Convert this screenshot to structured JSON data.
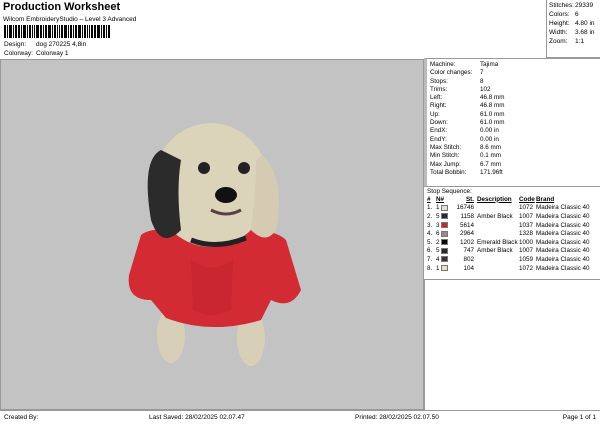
{
  "header": {
    "title": "Production Worksheet",
    "subtitle": "Wilcom EmbroideryStudio – Level 3 Advanced",
    "design_label": "Design:",
    "design_value": "dog 270225 4,8in",
    "colorway_label": "Colorway:",
    "colorway_value": "Colorway 1"
  },
  "stats": [
    {
      "k": "Stitches:",
      "v": "29339"
    },
    {
      "k": "Colors:",
      "v": "6"
    },
    {
      "k": "Height:",
      "v": "4.80 in"
    },
    {
      "k": "Width:",
      "v": "3.68 in"
    },
    {
      "k": "Zoom:",
      "v": "1:1"
    }
  ],
  "info": [
    {
      "k": "Machine:",
      "v": "Tajima"
    },
    {
      "k": "Color changes:",
      "v": "7"
    },
    {
      "k": "Stops:",
      "v": "8"
    },
    {
      "k": "Trims:",
      "v": "102"
    },
    {
      "k": "Left:",
      "v": "46.8 mm"
    },
    {
      "k": "Right:",
      "v": "46.8 mm"
    },
    {
      "k": "Up:",
      "v": "61.0 mm"
    },
    {
      "k": "Down:",
      "v": "61.0 mm"
    },
    {
      "k": "EndX:",
      "v": "0.00 in"
    },
    {
      "k": "EndY:",
      "v": "0.00 in"
    },
    {
      "k": "Max Stitch:",
      "v": "8.6 mm"
    },
    {
      "k": "Min Stitch:",
      "v": "0.1 mm"
    },
    {
      "k": "Max Jump:",
      "v": "6.7 mm"
    },
    {
      "k": "Total Bobbin:",
      "v": "171.96ft"
    }
  ],
  "sequence": {
    "title": "Stop Sequence:",
    "headers": [
      "#",
      "N#",
      "St.",
      "Description",
      "Code",
      "Brand"
    ],
    "rows": [
      {
        "n": "1.",
        "c": "1",
        "color": "#e6dfcf",
        "st": "16746",
        "desc": "",
        "code": "1072",
        "brand": "Madeira Classic 40"
      },
      {
        "n": "2.",
        "c": "5",
        "color": "#2a2a2a",
        "st": "1158",
        "desc": "Amber Black",
        "code": "1007",
        "brand": "Madeira Classic 40"
      },
      {
        "n": "3.",
        "c": "3",
        "color": "#d0202a",
        "st": "5614",
        "desc": "",
        "code": "1037",
        "brand": "Madeira Classic 40"
      },
      {
        "n": "4.",
        "c": "6",
        "color": "#a08a7a",
        "st": "2964",
        "desc": "",
        "code": "1328",
        "brand": "Madeira Classic 40"
      },
      {
        "n": "5.",
        "c": "2",
        "color": "#050505",
        "st": "1202",
        "desc": "Emerald Black",
        "code": "1000",
        "brand": "Madeira Classic 40"
      },
      {
        "n": "6.",
        "c": "5",
        "color": "#2a2a2a",
        "st": "747",
        "desc": "Amber Black",
        "code": "1007",
        "brand": "Madeira Classic 40"
      },
      {
        "n": "7.",
        "c": "4",
        "color": "#3a3434",
        "st": "802",
        "desc": "",
        "code": "1059",
        "brand": "Madeira Classic 40"
      },
      {
        "n": "8.",
        "c": "1",
        "color": "#e6dfcf",
        "st": "104",
        "desc": "",
        "code": "1072",
        "brand": "Madeira Classic 40"
      }
    ]
  },
  "footer": {
    "created": "Created By:",
    "saved": "Last Saved: 28/02/2025 02.07.47",
    "printed": "Printed: 28/02/2025 02.07.50",
    "page": "Page 1 of 1"
  }
}
